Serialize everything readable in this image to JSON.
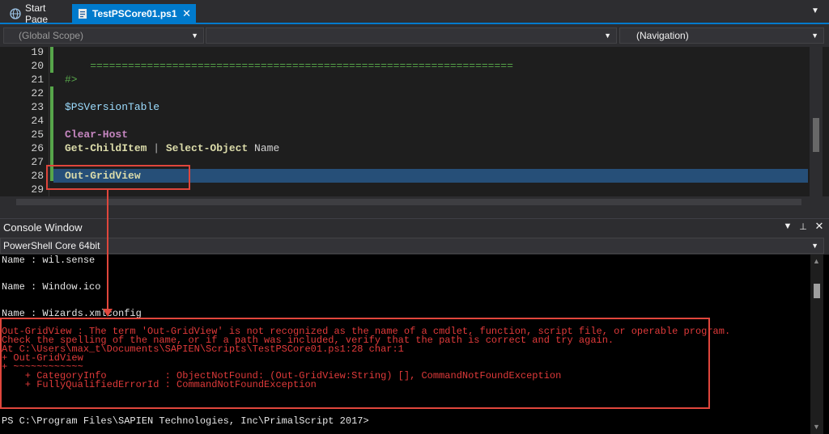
{
  "tabs": [
    {
      "label": "Start Page",
      "icon": "globe-icon",
      "active": false
    },
    {
      "label": "TestPSCore01.ps1",
      "icon": "script-icon",
      "active": true,
      "close": "✕"
    }
  ],
  "combos": {
    "scope": "(Global Scope)",
    "middle": "",
    "navigation": "(Navigation)"
  },
  "editor": {
    "line_numbers": [
      "19",
      "20",
      "21",
      "22",
      "23",
      "24",
      "25",
      "26",
      "27",
      "28",
      "29"
    ],
    "lines": {
      "l20": "    ===================================================================",
      "l21": "#>",
      "l23": "$PSVersionTable",
      "l25": "Clear-Host",
      "l26_cmd1": "Get-ChildItem",
      "l26_pipe": " | ",
      "l26_cmd2": "Select-Object",
      "l26_arg": " Name",
      "l28": "Out-GridView"
    }
  },
  "console": {
    "title": "Console Window",
    "shell": "PowerShell Core 64bit",
    "output": [
      "Name : wil.sense",
      "Name : Window.ico",
      "Name : Wizards.xmlconfig"
    ],
    "error": [
      "Out-GridView : The term 'Out-GridView' is not recognized as the name of a cmdlet, function, script file, or operable program.",
      "Check the spelling of the name, or if a path was included, verify that the path is correct and try again.",
      "At C:\\Users\\max_t\\Documents\\SAPIEN\\Scripts\\TestPSCore01.ps1:28 char:1",
      "+ Out-GridView",
      "+ ~~~~~~~~~~~~",
      "    + CategoryInfo          : ObjectNotFound: (Out-GridView:String) [], CommandNotFoundException",
      "    + FullyQualifiedErrorId : CommandNotFoundException"
    ],
    "prompt": "PS C:\\Program Files\\SAPIEN Technologies, Inc\\PrimalScript 2017>"
  },
  "colors": {
    "accent": "#007acc",
    "annotation": "#e0463c",
    "error_text": "#e03a3a",
    "keyword": "#c586c0",
    "cmdlet": "#dcdcaa",
    "comment": "#57a64a"
  }
}
